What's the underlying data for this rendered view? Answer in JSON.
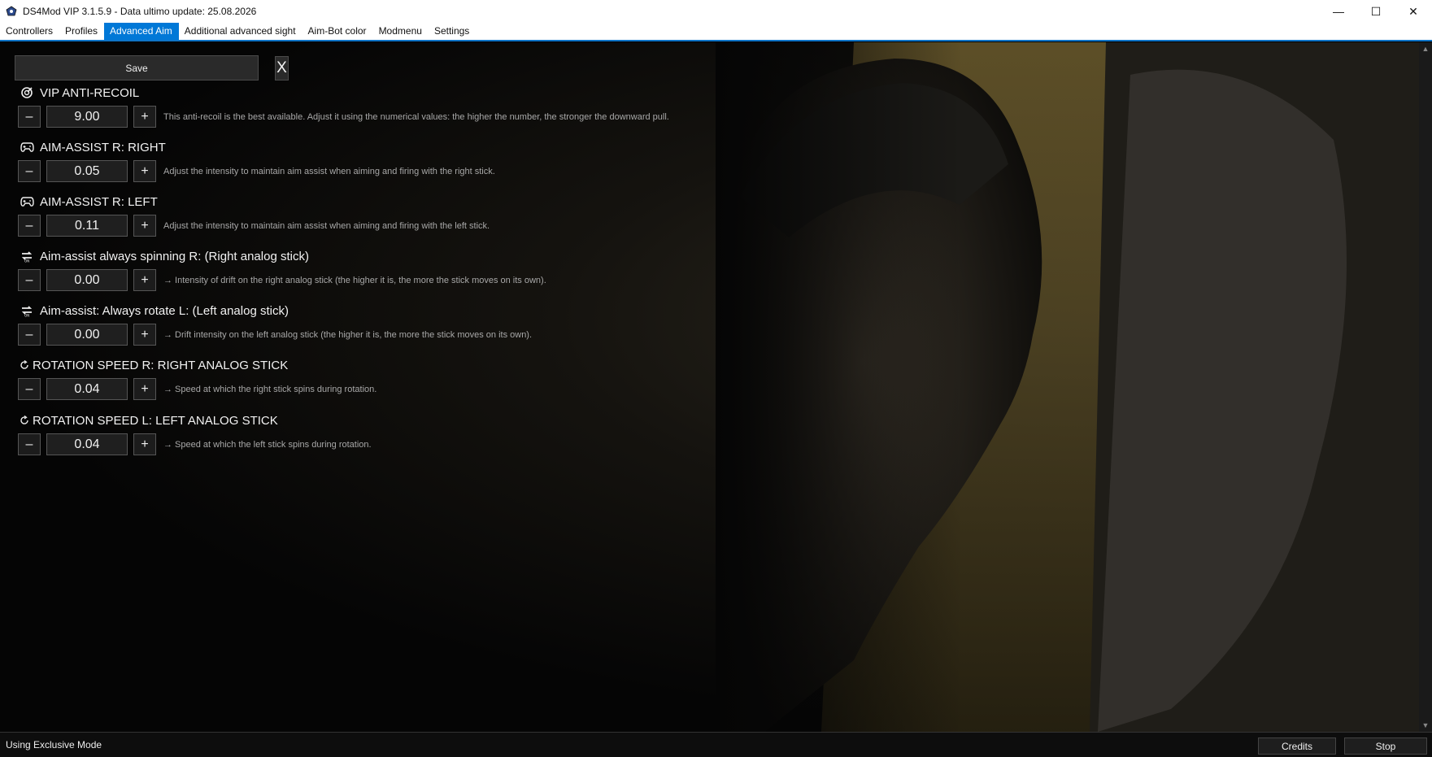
{
  "window": {
    "title": "DS4Mod VIP 3.1.5.9 - Data ultimo update: 25.08.2026",
    "controls": {
      "minimize": "—",
      "maximize": "☐",
      "close": "✕"
    }
  },
  "tabs": [
    {
      "label": "Controllers",
      "active": false
    },
    {
      "label": "Profiles",
      "active": false
    },
    {
      "label": "Advanced Aim",
      "active": true
    },
    {
      "label": "Additional advanced sight",
      "active": false
    },
    {
      "label": "Aim-Bot color",
      "active": false
    },
    {
      "label": "Modmenu",
      "active": false
    },
    {
      "label": "Settings",
      "active": false
    }
  ],
  "toolbar": {
    "save_label": "Save",
    "close_label": "X"
  },
  "stepper": {
    "minus": "–",
    "plus": "+"
  },
  "settings": [
    {
      "icon": "target-icon",
      "title": "VIP ANTI-RECOIL",
      "value": "9.00",
      "description": "This anti-recoil is the best available. Adjust it using the numerical values: the higher the number, the stronger the downward pull."
    },
    {
      "icon": "gamepad-icon",
      "title": "AIM-ASSIST R: RIGHT",
      "value": "0.05",
      "description": "Adjust the intensity to maintain aim assist when aiming and firing with the right stick."
    },
    {
      "icon": "gamepad-icon",
      "title": "AIM-ASSIST R: LEFT",
      "value": "0.11",
      "description": "Adjust the intensity to maintain aim assist when aiming and firing with the left stick."
    },
    {
      "icon": "repeat-on-icon",
      "title": "Aim-assist always spinning R: (Right analog stick)",
      "value": "0.00",
      "description": "→ Intensity of drift on the right analog stick (the higher it is, the more the stick moves on its own)."
    },
    {
      "icon": "repeat-on-icon",
      "title": "Aim-assist: Always rotate L: (Left analog stick)",
      "value": "0.00",
      "description": "→ Drift intensity on the left analog stick (the higher it is, the more the stick moves on its own)."
    },
    {
      "icon": "rotate-icon",
      "title": "ROTATION SPEED R: RIGHT ANALOG STICK",
      "value": "0.04",
      "description": "→ Speed at which the right stick spins during rotation."
    },
    {
      "icon": "rotate-icon",
      "title": "ROTATION SPEED L: LEFT ANALOG STICK",
      "value": "0.04",
      "description": "→ Speed at which the left stick spins during rotation."
    }
  ],
  "statusbar": {
    "text": "Using Exclusive Mode",
    "credits_label": "Credits",
    "stop_label": "Stop"
  },
  "colors": {
    "accent": "#0078d7",
    "background": "#000000",
    "panel": "#1f1f1f"
  }
}
